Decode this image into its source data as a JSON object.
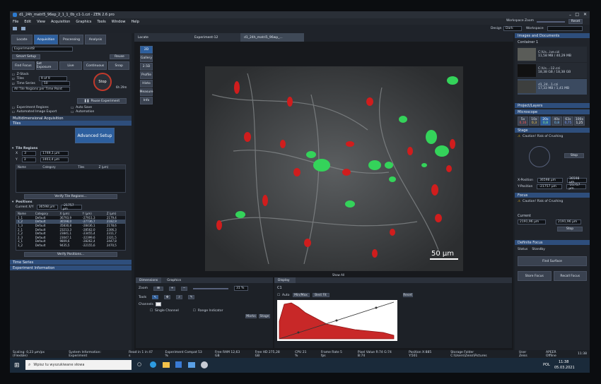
{
  "window": {
    "title": "d1_24h_matri5_96ep_2_1_1_0b_c1-1.czi - ZEN 2.6 pro"
  },
  "menu": [
    "File",
    "Edit",
    "View",
    "Acquisition",
    "Graphics",
    "Tools",
    "Window",
    "Help"
  ],
  "workspace": {
    "zoom_label": "Workspace Zoom",
    "reset": "Reset",
    "design_label": "Design",
    "design_value": "Dark",
    "workspace_label": "Workspace"
  },
  "main_tabs": [
    "Locate",
    "Acquisition",
    "Processing",
    "Analysis"
  ],
  "doc_tabs": [
    "Locate",
    "Experiment-12",
    "d1_24h_matri5_96wp_..."
  ],
  "left": {
    "experiment": "Experiment8",
    "smart_setup": "Smart Setup",
    "reuse": "Reuse",
    "buttons": [
      "Find Focus",
      "Set Exposure",
      "Live",
      "Continuous",
      "Snap"
    ],
    "zstack": "Z-Stack",
    "tiles_label": "Tiles",
    "tiles_value": "9 of 9",
    "timeseries_label": "Time Series",
    "timeseries_value": "50",
    "all_tile": "All Tile Regions per Time Point",
    "stop": "Stop",
    "time_left": "6h 29m",
    "pause": "Pause Experiment",
    "exp_regions": "Experiment Regions",
    "auto_image": "Automated Image Export",
    "auto_save": "Auto Save",
    "automation": "Automation",
    "multidim": "Multidimensional Acquisition",
    "tiles_section": "Tiles",
    "advanced_setup": "Advanced Setup",
    "tile_regions": "Tile Regions",
    "x_label": "X",
    "x_count": "3",
    "x_value": "1749,1 µm",
    "y_label": "Y",
    "y_count": "3",
    "y_value": "1403,4 µm",
    "region_cols": [
      "Name",
      "Category",
      "Tiles",
      "Z (µm)"
    ],
    "verify_regions": "Verify Tile Regions...",
    "positions": "Positions",
    "current_xy_label": "Current X/Y",
    "current_x": "36598 µm",
    "current_y": "-21757 µm",
    "pos_cols": [
      "Name",
      "Category",
      "X (µm)",
      "Y (µm)",
      "Z (µm)"
    ],
    "pos_rows": [
      [
        "1_1",
        "Default",
        "36793,9",
        "-27911,3",
        "2179,4"
      ],
      [
        "1_2",
        "Default",
        "36598,0",
        "-27736,7",
        "2182,9"
      ],
      [
        "1_3",
        "Default",
        "35830,8",
        "-28436,1",
        "2178,6"
      ],
      [
        "2_1",
        "Default",
        "23213,3",
        "-28562,0",
        "2306,3"
      ],
      [
        "2_2",
        "Default",
        "23841,1",
        "-23455,4",
        "2311,7"
      ],
      [
        "2_3",
        "Default",
        "23047,1",
        "-22399,6",
        "2321,5"
      ],
      [
        "3_1",
        "Default",
        "9809,6",
        "-28262,4",
        "2447,8"
      ],
      [
        "3_2",
        "Default",
        "9435,5",
        "-22155,6",
        "2470,5"
      ]
    ],
    "verify_positions": "Verify Positions...",
    "time_series": "Time Series",
    "exp_info": "Experiment Information"
  },
  "viewer": {
    "side_tools": [
      "2D",
      "Gallery",
      "2.5D",
      "Profile",
      "Histo",
      "Measure",
      "Info"
    ],
    "scale_bar": "50 µm",
    "show_all": "Show All",
    "tabs": [
      "Dimensions",
      "Graphics"
    ],
    "zoom_label": "Zoom",
    "zoom_value": "31 %",
    "tools_label": "Tools",
    "channels_label": "Channels",
    "single_channel": "Single Channel",
    "range_indicator": "Range Indicator",
    "marks": "Marks",
    "stage": "Stage",
    "display_tab": "Display",
    "channel": "C1",
    "auto": "Auto",
    "minmax": "Min/Max",
    "bestfit": "Best Fit",
    "reset": "Reset"
  },
  "right": {
    "images_docs": "Images and Documents",
    "container": "Container 1",
    "docs": [
      {
        "name": "C:\\Us...ive.czi",
        "size": "11,58 MB / 40,29 MB"
      },
      {
        "name": "C:\\Us...-12.czi",
        "size": "18,38 GB / 18,38 GB"
      },
      {
        "name": "d1_24...1.czi",
        "size": "17,33 MB / 1,41 MB"
      }
    ],
    "projects": "Project/Layers",
    "microscope": "Microscope",
    "objectives": [
      "5x",
      "10x",
      "20x",
      "40x",
      "63x",
      "100x"
    ],
    "objective_na": [
      "0,16",
      "0,3",
      "0,8",
      "0,8",
      "0,75",
      "1,25"
    ],
    "stage": "Stage",
    "caution": "Caution! Risk of Crushing",
    "stop": "Stop",
    "x_pos_label": "X-Position",
    "x_pos": "36598 µm",
    "y_pos_label": "Y-Position",
    "y_pos": "-21757 µm",
    "focus": "Focus",
    "focus_caution": "Caution! Risk of Crushing",
    "current_label": "Current",
    "current_value": "2191,96 µm",
    "set_value": "2191,96 µm",
    "focus_stop": "Stop",
    "definite_focus": "Definite Focus",
    "status_label": "Status",
    "status_value": "Standby",
    "find_surface": "Find Surface",
    "store_focus": "Store Focus",
    "recall_focus": "Recall Focus"
  },
  "status": {
    "scaling": "Scaling: 0,23 µm/px (Flexible)",
    "sys_info": "System Information: Experiment",
    "read_in": "Read in 1 in 47 s",
    "compat": "Experiment Compat 53 %",
    "ram": "Free RAM 12,63 GB",
    "hd": "Free HD 275,28 GB",
    "cpu": "CPU 21 %",
    "frame": "Frame Rate 5 fps",
    "pixel": "Pixel Value R:74 G:74 B:74",
    "position": "Position X:885 Y:501",
    "storage": "Storage Folder C:\\Users\\Zeiss\\Pictures",
    "user": "User Zeiss",
    "apeer": "APEER Offline",
    "time": "11:38"
  },
  "taskbar": {
    "search": "Wpisz tu wyszukiwane słowa",
    "lang": "POL",
    "time": "11:38",
    "date": "05.03.2021"
  }
}
